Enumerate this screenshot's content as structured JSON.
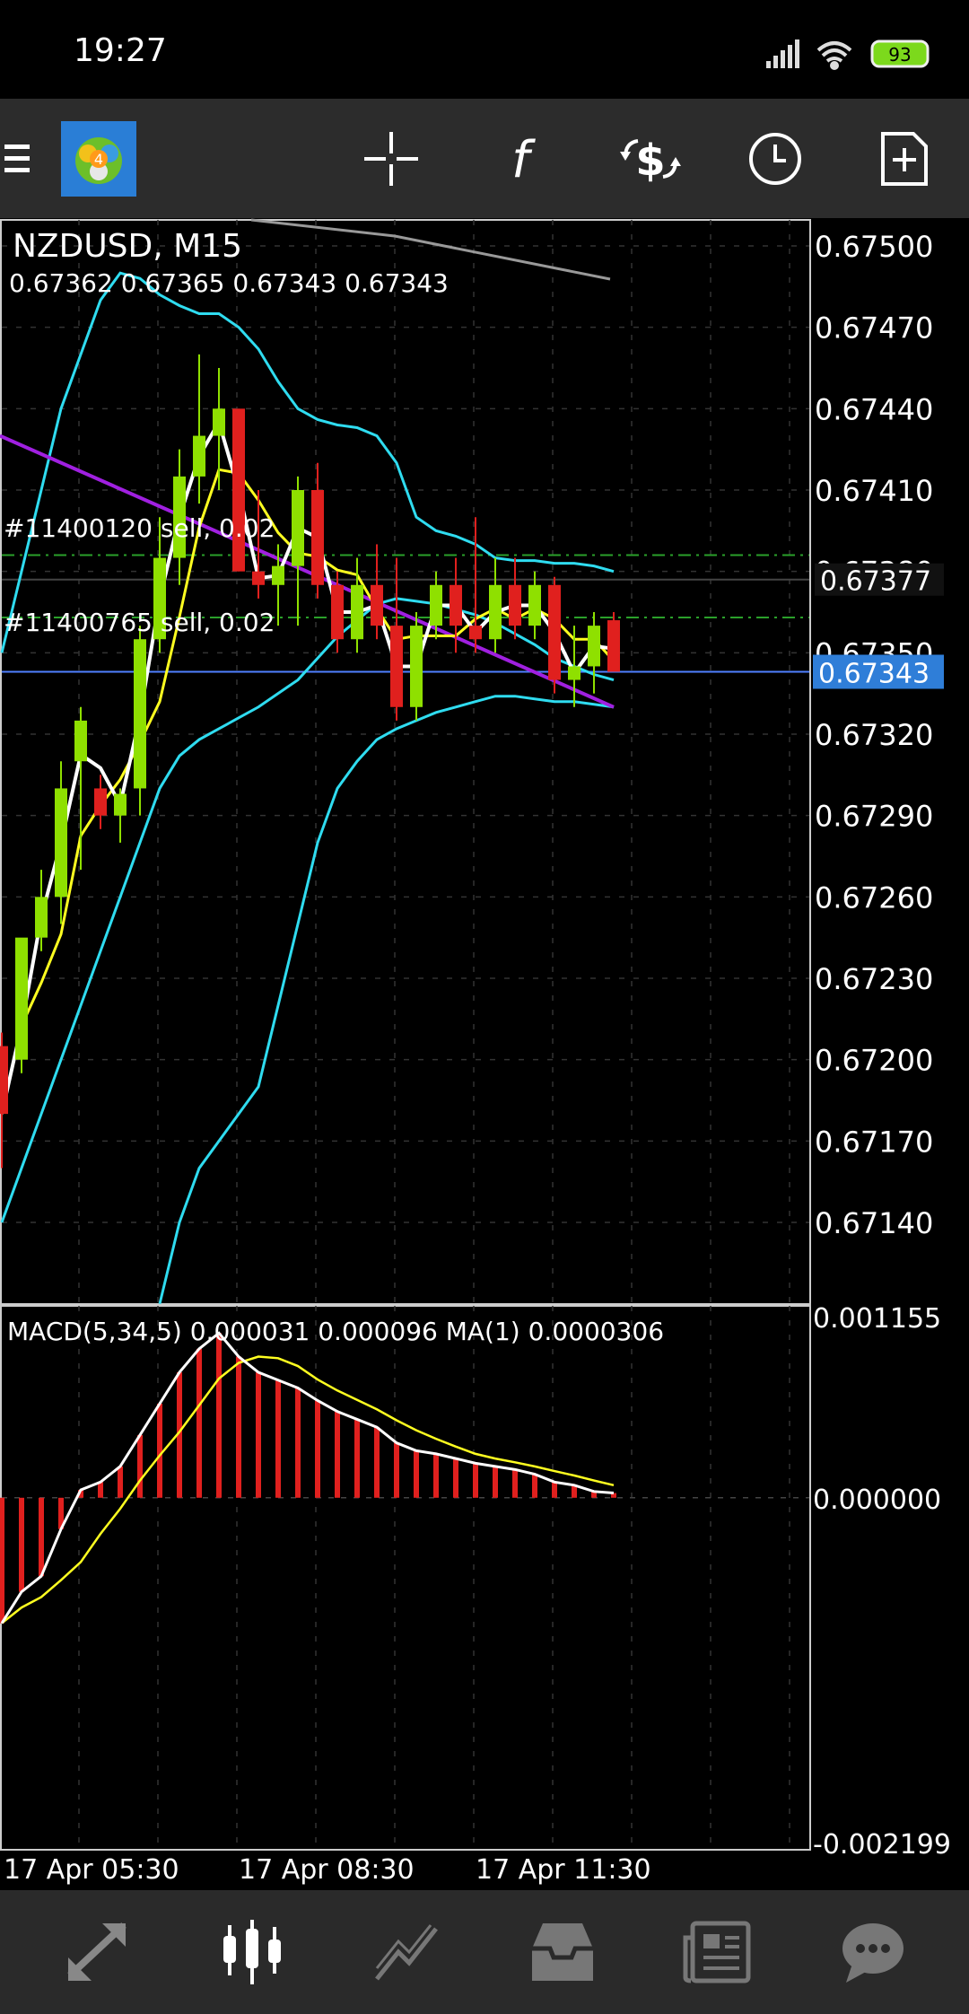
{
  "status": {
    "time": "19:27",
    "battery": "93"
  },
  "toolbar": {
    "menu_icon": "menu-icon",
    "app_icon": "metatrader-logo",
    "buttons": [
      "crosshair-icon",
      "function-icon",
      "trade-icon",
      "clock-icon",
      "new-document-icon"
    ]
  },
  "chart": {
    "symbol_title": "NZDUSD, M15",
    "ohlc": "0.67362 0.67365 0.67343 0.67343",
    "orders": [
      {
        "label": "#11400120 sell, 0.02"
      },
      {
        "label": "#11400765 sell, 0.02"
      }
    ],
    "price_labels": [
      "0.67500",
      "0.67470",
      "0.67440",
      "0.67410",
      "0.67380",
      "0.67350",
      "0.67320",
      "0.67290",
      "0.67260",
      "0.67230",
      "0.67200",
      "0.67170",
      "0.67140"
    ],
    "current_price": "0.67377",
    "bid_price": "0.67343",
    "macd_label": "MACD(5,34,5) 0.000031 0.000096 MA(1) 0.0000306",
    "macd_scale": [
      "0.001155",
      "0.000000",
      "-0.002199"
    ],
    "time_labels": [
      "17 Apr 05:30",
      "17 Apr 08:30",
      "17 Apr 11:30"
    ],
    "colors": {
      "bull": "#8fe000",
      "bear": "#e0201e",
      "bollinger": "#2fdcf0",
      "ma_yellow": "#ffff20",
      "ma_white": "#ffffff",
      "trend": "#a020e0",
      "bid_line": "#4f7fff",
      "grid": "#333333"
    }
  },
  "chart_data": {
    "type": "candlestick",
    "title": "NZDUSD, M15",
    "ylim": [
      0.6711,
      0.6751
    ],
    "candles": [
      {
        "o": 0.67205,
        "h": 0.6721,
        "l": 0.6716,
        "c": 0.6718
      },
      {
        "o": 0.672,
        "h": 0.6723,
        "l": 0.67195,
        "c": 0.67245
      },
      {
        "o": 0.67245,
        "h": 0.6727,
        "l": 0.6724,
        "c": 0.6726
      },
      {
        "o": 0.6726,
        "h": 0.6731,
        "l": 0.6725,
        "c": 0.673
      },
      {
        "o": 0.6731,
        "h": 0.6733,
        "l": 0.6727,
        "c": 0.67325
      },
      {
        "o": 0.673,
        "h": 0.67305,
        "l": 0.67285,
        "c": 0.6729
      },
      {
        "o": 0.6729,
        "h": 0.673,
        "l": 0.6728,
        "c": 0.67298
      },
      {
        "o": 0.673,
        "h": 0.6736,
        "l": 0.6729,
        "c": 0.67355
      },
      {
        "o": 0.67355,
        "h": 0.674,
        "l": 0.6735,
        "c": 0.67385
      },
      {
        "o": 0.67385,
        "h": 0.67425,
        "l": 0.67375,
        "c": 0.67415
      },
      {
        "o": 0.67415,
        "h": 0.6746,
        "l": 0.67405,
        "c": 0.6743
      },
      {
        "o": 0.6743,
        "h": 0.67455,
        "l": 0.6741,
        "c": 0.6744
      },
      {
        "o": 0.6744,
        "h": 0.6744,
        "l": 0.6738,
        "c": 0.6738
      },
      {
        "o": 0.6738,
        "h": 0.6741,
        "l": 0.6737,
        "c": 0.67375
      },
      {
        "o": 0.67375,
        "h": 0.6739,
        "l": 0.6736,
        "c": 0.67382
      },
      {
        "o": 0.67382,
        "h": 0.67415,
        "l": 0.6736,
        "c": 0.6741
      },
      {
        "o": 0.6741,
        "h": 0.6742,
        "l": 0.6737,
        "c": 0.67375
      },
      {
        "o": 0.67375,
        "h": 0.6738,
        "l": 0.6735,
        "c": 0.67355
      },
      {
        "o": 0.67355,
        "h": 0.67385,
        "l": 0.6735,
        "c": 0.67375
      },
      {
        "o": 0.67375,
        "h": 0.6739,
        "l": 0.67355,
        "c": 0.6736
      },
      {
        "o": 0.6736,
        "h": 0.67385,
        "l": 0.67325,
        "c": 0.6733
      },
      {
        "o": 0.6733,
        "h": 0.67365,
        "l": 0.67325,
        "c": 0.6736
      },
      {
        "o": 0.6736,
        "h": 0.6738,
        "l": 0.67355,
        "c": 0.67375
      },
      {
        "o": 0.67375,
        "h": 0.67385,
        "l": 0.6735,
        "c": 0.6736
      },
      {
        "o": 0.6736,
        "h": 0.674,
        "l": 0.6735,
        "c": 0.67355
      },
      {
        "o": 0.67355,
        "h": 0.67385,
        "l": 0.6735,
        "c": 0.67375
      },
      {
        "o": 0.67375,
        "h": 0.67385,
        "l": 0.67355,
        "c": 0.6736
      },
      {
        "o": 0.6736,
        "h": 0.6738,
        "l": 0.67355,
        "c": 0.67375
      },
      {
        "o": 0.67375,
        "h": 0.67378,
        "l": 0.67335,
        "c": 0.6734
      },
      {
        "o": 0.6734,
        "h": 0.6736,
        "l": 0.6733,
        "c": 0.67345
      },
      {
        "o": 0.67345,
        "h": 0.67365,
        "l": 0.67335,
        "c": 0.6736
      },
      {
        "o": 0.67362,
        "h": 0.67365,
        "l": 0.67343,
        "c": 0.67343
      }
    ],
    "macd_hist": [
      -0.0008,
      -0.0006,
      -0.0005,
      -0.0002,
      5e-05,
      0.0001,
      0.0002,
      0.0004,
      0.0006,
      0.0008,
      0.00095,
      0.00105,
      0.0009,
      0.0008,
      0.00075,
      0.0007,
      0.00062,
      0.00055,
      0.0005,
      0.00045,
      0.00035,
      0.0003,
      0.00028,
      0.00025,
      0.00022,
      0.0002,
      0.00018,
      0.00015,
      0.0001,
      8e-05,
      4e-05,
      3e-05
    ],
    "macd_ylim": [
      -0.002199,
      0.001155
    ]
  },
  "bottom_nav": [
    "quotes-icon",
    "chart-icon",
    "trade-icon",
    "history-icon",
    "news-icon",
    "chat-icon"
  ]
}
